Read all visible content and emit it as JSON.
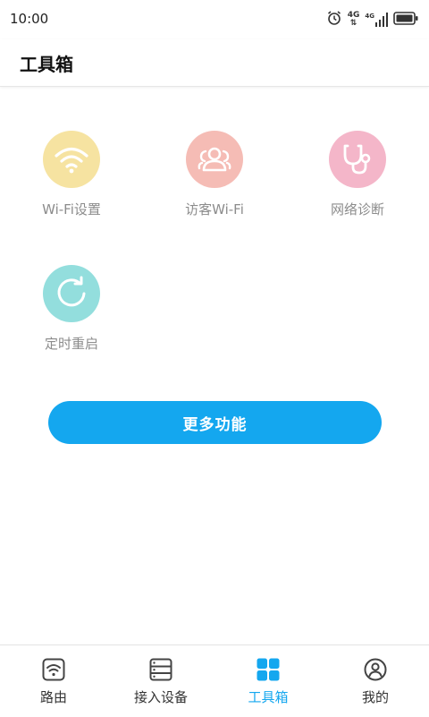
{
  "status_bar": {
    "time": "10:00",
    "network_label": "4G",
    "network_label_small": "4G",
    "icons": [
      "alarm-icon",
      "signal-icon",
      "battery-icon"
    ]
  },
  "header": {
    "title": "工具箱"
  },
  "tools": [
    {
      "label": "Wi-Fi设置",
      "icon": "wifi-icon",
      "color": "#f6e3a1"
    },
    {
      "label": "访客Wi-Fi",
      "icon": "guests-icon",
      "color": "#f5bcb5"
    },
    {
      "label": "网络诊断",
      "icon": "stethoscope-icon",
      "color": "#f4b6c9"
    },
    {
      "label": "定时重启",
      "icon": "restart-icon",
      "color": "#93dedd"
    }
  ],
  "more_button": {
    "label": "更多功能",
    "color": "#14a7ef"
  },
  "bottom_nav": {
    "items": [
      {
        "label": "路由",
        "icon": "router-wifi-icon",
        "active": false
      },
      {
        "label": "接入设备",
        "icon": "devices-list-icon",
        "active": false
      },
      {
        "label": "工具箱",
        "icon": "toolbox-grid-icon",
        "active": true
      },
      {
        "label": "我的",
        "icon": "profile-icon",
        "active": false
      }
    ],
    "active_color": "#14a7ef"
  }
}
